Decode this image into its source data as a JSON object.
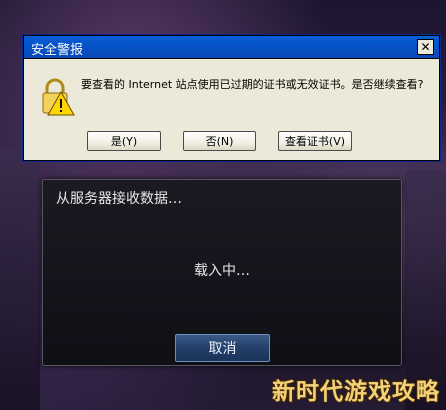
{
  "security_alert": {
    "title": "安全警报",
    "close_icon": "close-icon",
    "warning_icon": "padlock-warning-icon",
    "message": "要查看的 Internet 站点使用已过期的证书或无效证书。是否继续查看?",
    "buttons": {
      "yes": "是(Y)",
      "no": "否(N)",
      "view_cert": "查看证书(V)"
    }
  },
  "loading_dialog": {
    "title": "从服务器接收数据…",
    "status": "载入中…",
    "cancel": "取消"
  },
  "watermark": "新时代游戏攻略",
  "colors": {
    "xp_titlebar": "#0a5fd8",
    "xp_face": "#ece9d8",
    "cancel_button": "#23406b",
    "watermark": "#f3d27a"
  }
}
